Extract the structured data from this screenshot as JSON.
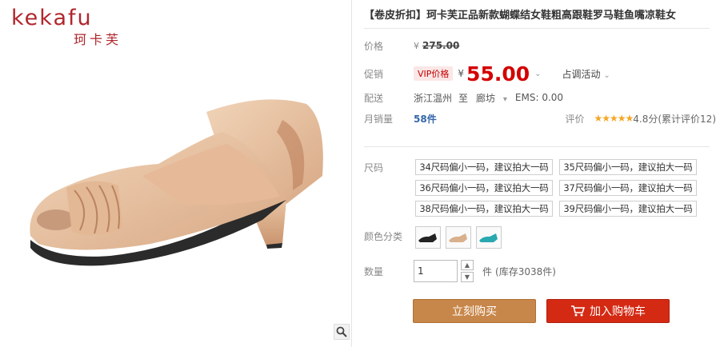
{
  "brand": {
    "logo_text": "kekafu",
    "logo_sub": "珂卡芙"
  },
  "product": {
    "title": "【卷皮折扣】珂卡芙正品新款蝴蝶结女鞋粗高跟鞋罗马鞋鱼嘴凉鞋女"
  },
  "price": {
    "label": "价格",
    "yen": "¥",
    "original": "275.00"
  },
  "promo": {
    "label": "促销",
    "vip_tag": "VIP价格",
    "yen": "¥",
    "current": "55.00",
    "activity": "占调活动"
  },
  "shipping": {
    "label": "配送",
    "from": "浙江温州",
    "to_word": "至",
    "destination": "廊坊",
    "ems": "EMS: 0.00"
  },
  "sales": {
    "label": "月销量",
    "count": "58件",
    "rating_label": "评价",
    "stars": "★★★★★",
    "score": "4.8分(累计评价12)"
  },
  "size": {
    "label": "尺码",
    "options": [
      "34尺码偏小一码，建议拍大一码",
      "35尺码偏小一码，建议拍大一码",
      "36尺码偏小一码，建议拍大一码",
      "37尺码偏小一码，建议拍大一码",
      "38尺码偏小一码，建议拍大一码",
      "39尺码偏小一码，建议拍大一码"
    ]
  },
  "color": {
    "label": "颜色分类",
    "swatches": [
      "black",
      "beige",
      "teal"
    ],
    "swatch_colors": [
      "#222222",
      "#d9b08c",
      "#2aa8b0"
    ]
  },
  "quantity": {
    "label": "数量",
    "value": "1",
    "unit": "件",
    "stock": "(库存3038件)"
  },
  "actions": {
    "buy_now": "立刻购买",
    "add_cart": "加入购物车"
  },
  "colors": {
    "brand_red": "#b0262c",
    "price_red": "#d40000",
    "buy_brown": "#c8874a",
    "cart_red": "#d42a14"
  }
}
